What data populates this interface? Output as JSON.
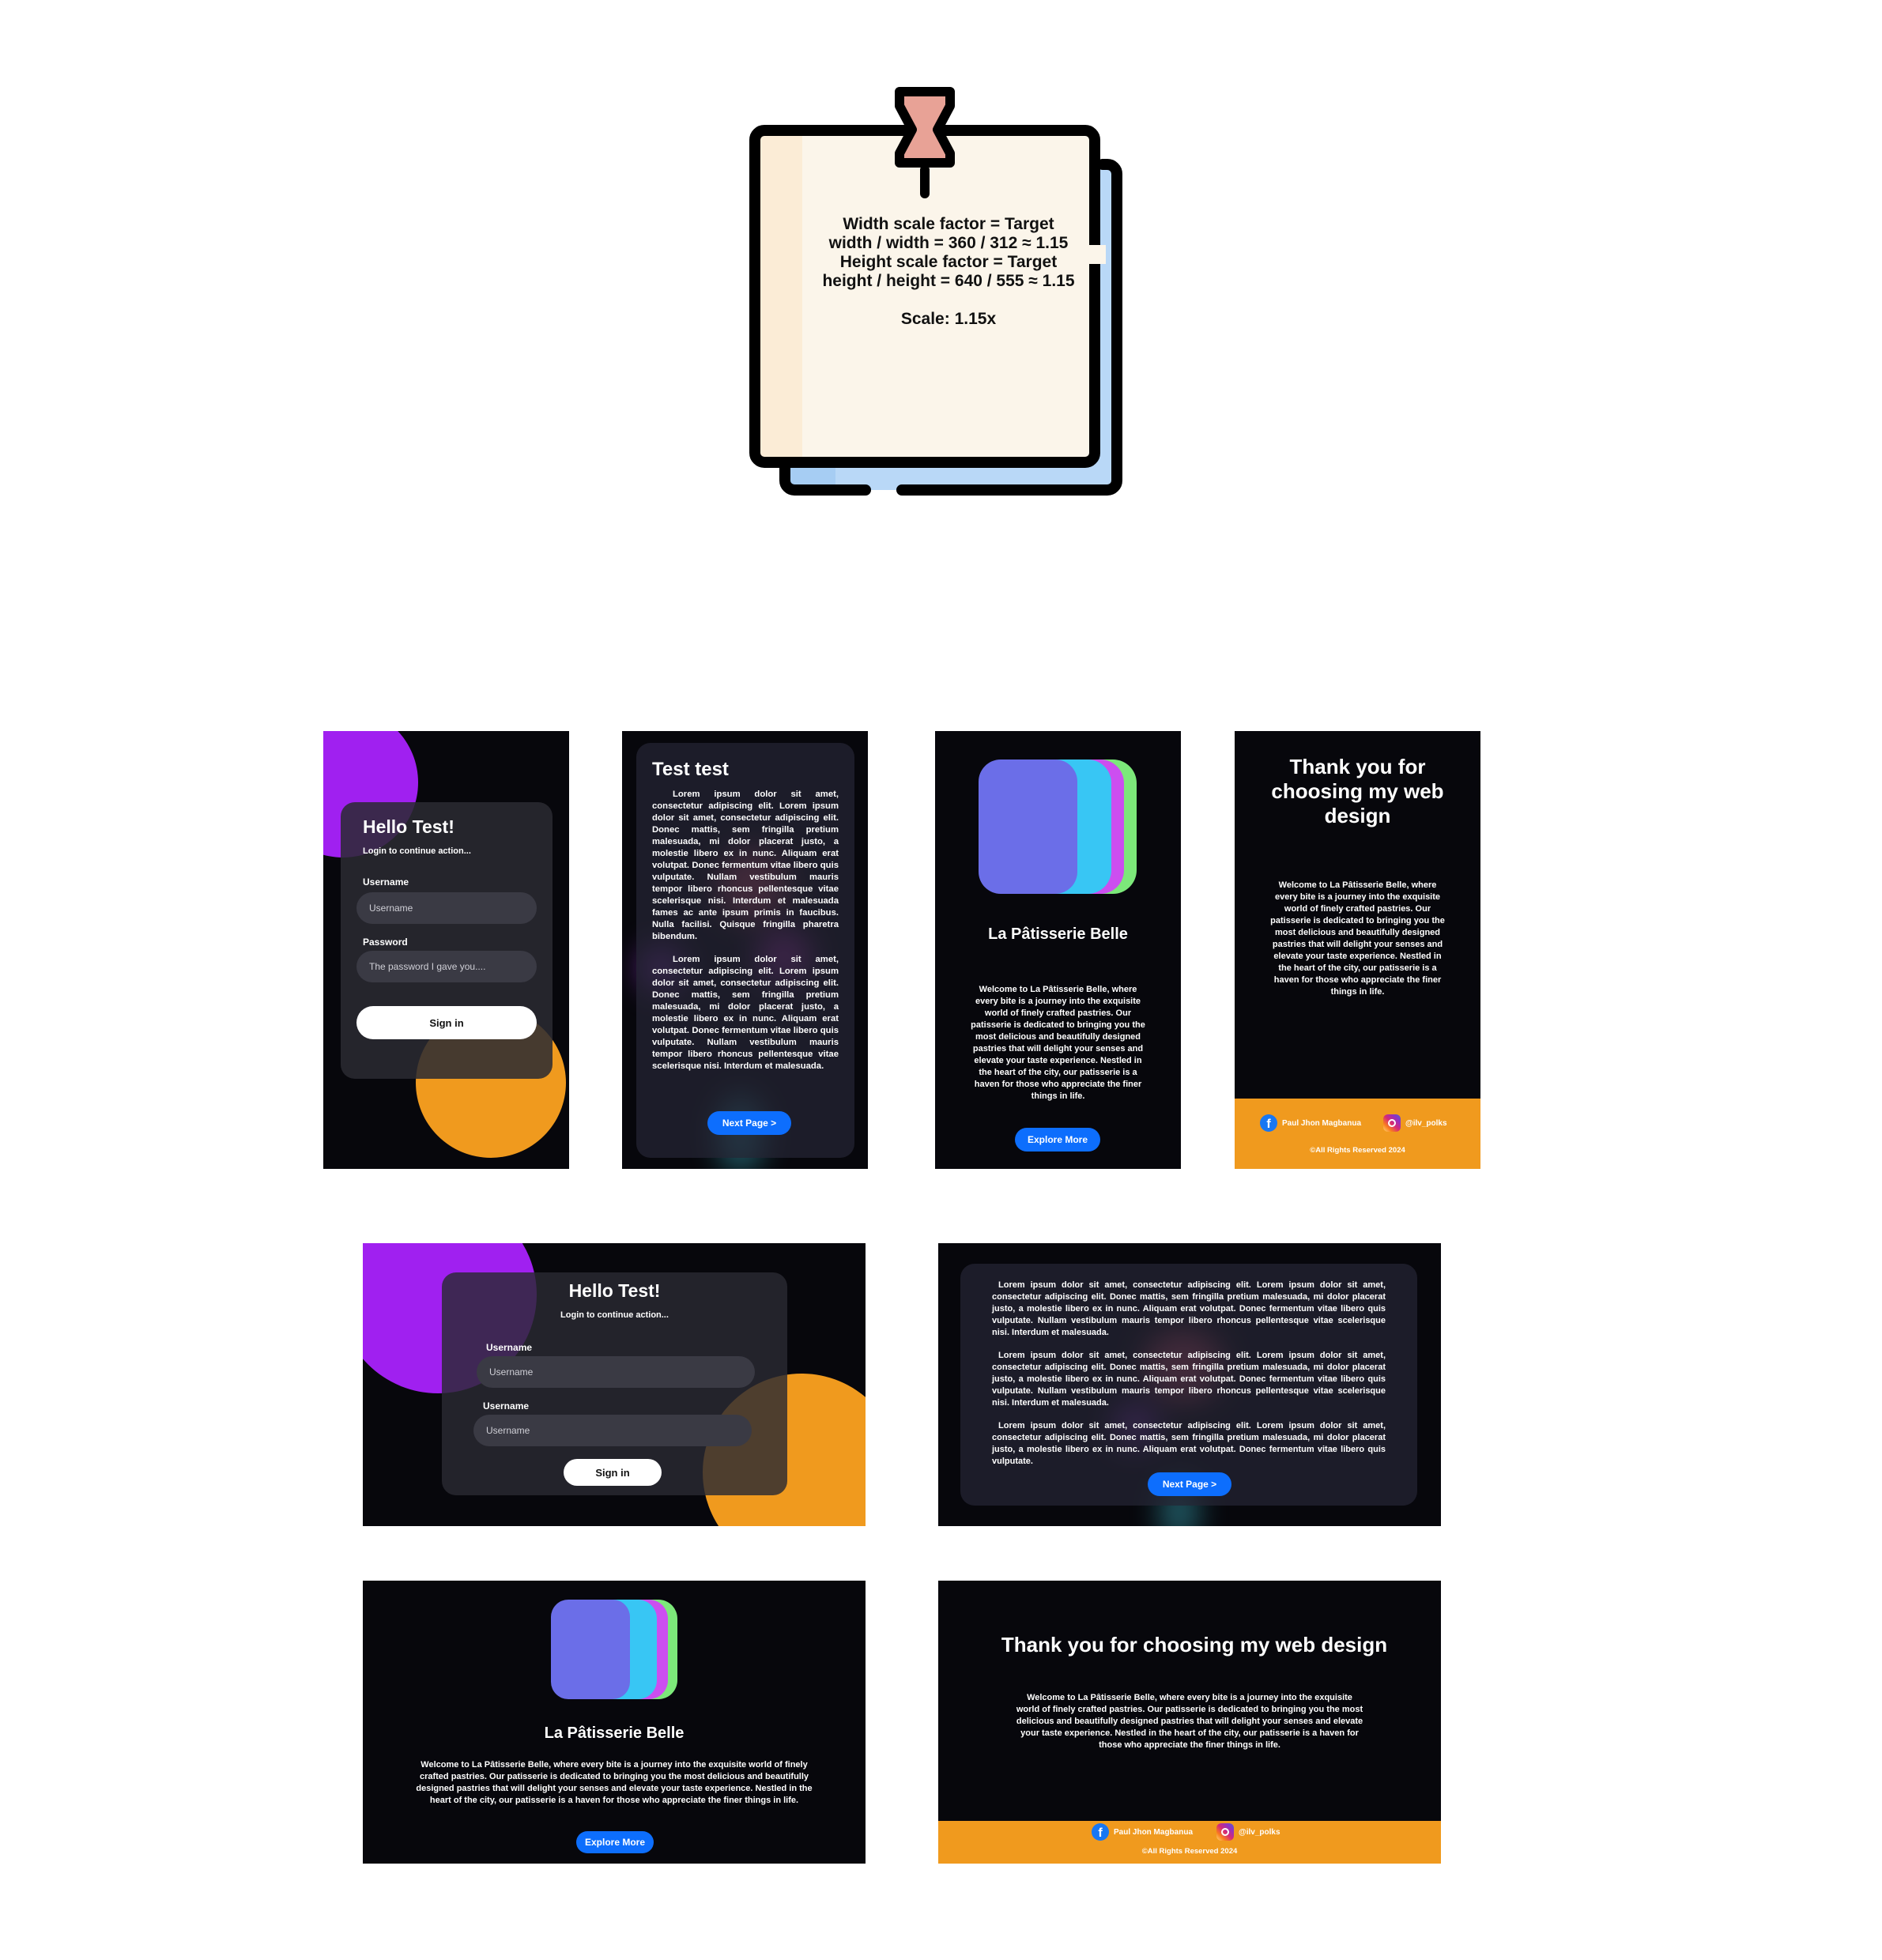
{
  "note": {
    "lines": [
      "Width scale factor = Target width /  width = 360 / 312 ≈ 1.15",
      "Height scale factor = Target height / height = 640 / 555 ≈ 1.15",
      "",
      "Scale: 1.15x"
    ]
  },
  "login": {
    "title": "Hello Test!",
    "subtitle": "Login to continue action...",
    "username_label": "Username",
    "username_placeholder": "Username",
    "password_label": "Password",
    "password_placeholder": "The password I gave you....",
    "sign_in": "Sign in"
  },
  "login_desktop": {
    "title": "Hello Test!",
    "subtitle": "Login to continue action...",
    "username_label": "Username",
    "username_placeholder": "Username",
    "second_label": "Username",
    "second_placeholder": "Username",
    "sign_in": "Sign in"
  },
  "article": {
    "title": "Test test",
    "paragraph_1": "Lorem ipsum dolor sit amet, consectetur adipiscing elit. Lorem ipsum dolor sit amet, consectetur adipiscing elit. Donec mattis, sem fringilla pretium malesuada, mi dolor placerat justo, a molestie libero ex in nunc. Aliquam erat volutpat. Donec fermentum vitae libero quis vulputate. Nullam vestibulum mauris tempor libero rhoncus pellentesque vitae scelerisque nisi. Interdum et malesuada fames ac ante ipsum primis in faucibus. Nulla facilisi. Quisque fringilla pharetra bibendum.",
    "paragraph_2": "Lorem ipsum dolor sit amet, consectetur adipiscing elit. Lorem ipsum dolor sit amet, consectetur adipiscing elit. Donec mattis, sem fringilla pretium malesuada, mi dolor placerat justo, a molestie libero ex in nunc. Aliquam erat volutpat. Donec fermentum vitae libero quis vulputate. Nullam vestibulum mauris tempor libero rhoncus pellentesque vitae scelerisque nisi. Interdum et malesuada.",
    "next": "Next Page >"
  },
  "article_desktop": {
    "paragraph_1": "Lorem ipsum dolor sit amet, consectetur adipiscing elit. Lorem ipsum dolor sit amet, consectetur adipiscing elit. Donec mattis, sem fringilla pretium malesuada, mi dolor placerat justo, a molestie libero ex in nunc. Aliquam erat volutpat. Donec fermentum vitae libero quis vulputate. Nullam vestibulum mauris tempor libero rhoncus pellentesque vitae scelerisque nisi. Interdum et malesuada.",
    "paragraph_2": "Lorem ipsum dolor sit amet, consectetur adipiscing elit. Lorem ipsum dolor sit amet, consectetur adipiscing elit. Donec mattis, sem fringilla pretium malesuada, mi dolor placerat justo, a molestie libero ex in nunc. Aliquam erat volutpat. Donec fermentum vitae libero quis vulputate. Nullam vestibulum mauris tempor libero rhoncus pellentesque vitae scelerisque nisi. Interdum et malesuada.",
    "paragraph_3": "Lorem ipsum dolor sit amet, consectetur adipiscing elit. Lorem ipsum dolor sit amet, consectetur adipiscing elit. Donec mattis, sem fringilla pretium malesuada, mi dolor placerat justo, a molestie libero ex in nunc. Aliquam erat volutpat. Donec fermentum vitae libero quis vulputate.",
    "next": "Next Page >"
  },
  "patisserie": {
    "name": "La Pâtisserie Belle",
    "description": "Welcome to La Pâtisserie Belle, where every bite is a journey into the exquisite world of finely crafted pastries. Our patisserie is dedicated to bringing you the most delicious and beautifully designed pastries that will delight your senses and elevate your taste experience. Nestled in the heart of the city, our patisserie is a haven for those who appreciate the finer things in life.",
    "cta": "Explore More"
  },
  "thanks": {
    "title": "Thank you for choosing my web design",
    "description": "Welcome to La Pâtisserie Belle, where every bite is a journey into the exquisite world of finely crafted pastries. Our patisserie is dedicated to bringing you the most delicious and beautifully designed pastries that will delight your senses and elevate your taste experience. Nestled in the heart of the city, our patisserie is a haven for those who appreciate the finer things in life.",
    "facebook_name": "Paul Jhon Magbanua",
    "instagram_handle": "@ilv_polks",
    "copyright": "©All Rights Reserved 2024"
  },
  "colors": {
    "purple": "#a020f0",
    "orange": "#f09a1e",
    "blue_button": "#0d6efd",
    "logo_front": "#6b6ee8",
    "logo_cyan": "#38c6f4",
    "logo_magenta": "#cc4ef0",
    "logo_green": "#7ce87a"
  }
}
